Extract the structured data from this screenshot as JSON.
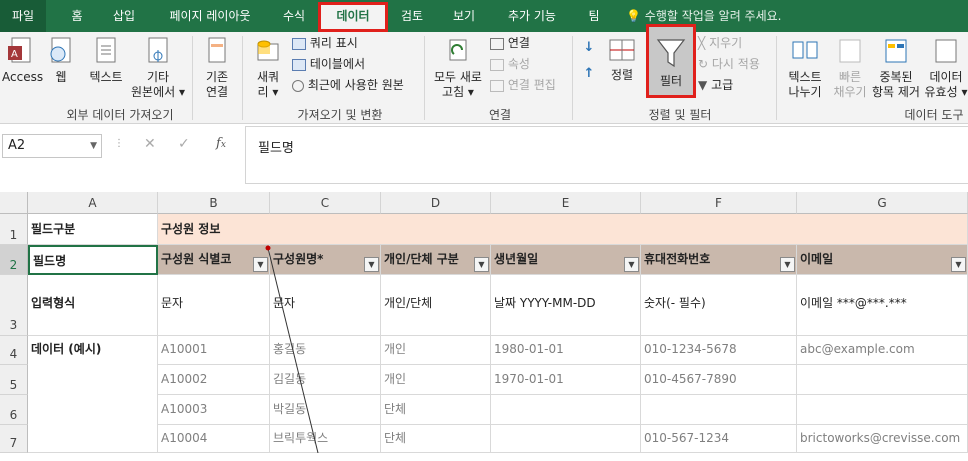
{
  "tabs": [
    "파일",
    "홈",
    "삽입",
    "페이지 레이아웃",
    "수식",
    "데이터",
    "검토",
    "보기",
    "추가 기능",
    "팀"
  ],
  "tell_me": "수행할 작업을 알려 주세요.",
  "ribbon": {
    "get_external": {
      "access": "Access",
      "web": "웹",
      "text": "텍스트",
      "other_line1": "기타",
      "other_line2": "원본에서 ▾",
      "label": "외부 데이터 가져오기"
    },
    "get_transform": {
      "existing_line1": "기존",
      "existing_line2": "연결",
      "new_line1": "새쿼",
      "new_line2": "리 ▾",
      "show_queries": "쿼리 표시",
      "from_table": "테이블에서",
      "recent_sources": "최근에 사용한 원본",
      "label": "가져오기 및 변환"
    },
    "connections": {
      "refresh_line1": "모두 새로",
      "refresh_line2": "고침 ▾",
      "connections": "연결",
      "properties": "속성",
      "edit_links": "연결 편집",
      "label": "연결"
    },
    "sort_filter": {
      "sort": "정렬",
      "filter": "필터",
      "clear": "지우기",
      "reapply": "다시 적용",
      "advanced": "고급",
      "label": "정렬 및 필터"
    },
    "data_tools": {
      "text_col_line1": "텍스트",
      "text_col_line2": "나누기",
      "flash_line1": "빠른",
      "flash_line2": "채우기",
      "dup_line1": "중복된",
      "dup_line2": "항목 제거",
      "valid_line1": "데이터",
      "valid_line2": "유효성 ▾",
      "label": "데이터 도구"
    }
  },
  "formula_bar": {
    "name_box": "A2",
    "formula": "필드명"
  },
  "columns": [
    "A",
    "B",
    "C",
    "D",
    "E",
    "F",
    "G"
  ],
  "rows": {
    "r1": {
      "num": "1",
      "a": "필드구분",
      "b": "구성원 정보"
    },
    "r2": {
      "num": "2",
      "a": "필드명",
      "b": "구성원 식별코",
      "c": "구성원명*",
      "d": "개인/단체 구분",
      "e": "생년월일",
      "f": "휴대전화번호",
      "g": "이메일"
    },
    "r3": {
      "num": "3",
      "a": "입력형식",
      "b": "문자",
      "c": "문자",
      "d": "개인/단체",
      "e": "날짜 YYYY-MM-DD",
      "f": "숫자(- 필수)",
      "g": "이메일 ***@***.***"
    },
    "r4": {
      "num": "4",
      "a": "데이터 (예시)",
      "b": "A10001",
      "c": "홍길동",
      "d": "개인",
      "e": "1980-01-01",
      "f": "010-1234-5678",
      "g": "abc@example.com"
    },
    "r5": {
      "num": "5",
      "b": "A10002",
      "c": "김길동",
      "d": "개인",
      "e": "1970-01-01",
      "f": "010-4567-7890",
      "g": ""
    },
    "r6": {
      "num": "6",
      "b": "A10003",
      "c": "박길동",
      "d": "단체",
      "e": "",
      "f": "",
      "g": ""
    },
    "r7": {
      "num": "7",
      "b": "A10004",
      "c": "브릭투웍스",
      "d": "단체",
      "e": "",
      "f": "010-567-1234",
      "g": "brictoworks@crevisse.com"
    }
  },
  "colors": {
    "excel_green": "#217346",
    "highlight_red": "#e0201b",
    "header_fill": "#c9b8ac",
    "row1_fill": "#fce4d6"
  }
}
